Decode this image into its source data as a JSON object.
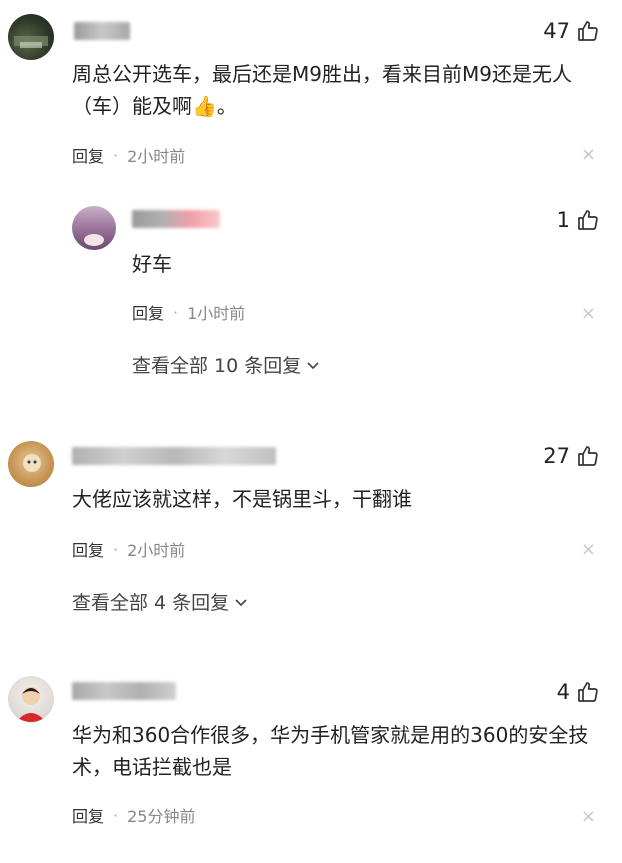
{
  "comments": [
    {
      "likes": "47",
      "text": "周总公开选车，最后还是M9胜出，看来目前M9还是无人（车）能及啊👍。",
      "reply_label": "回复",
      "time": "2小时前",
      "reply": {
        "likes": "1",
        "text": "好车",
        "reply_label": "回复",
        "time": "1小时前"
      },
      "view_all": "查看全部 10 条回复"
    },
    {
      "likes": "27",
      "text": "大佬应该就这样，不是锅里斗，干翻谁",
      "reply_label": "回复",
      "time": "2小时前",
      "view_all": "查看全部 4 条回复"
    },
    {
      "likes": "4",
      "text": "华为和360合作很多，华为手机管家就是用的360的安全技术，电话拦截也是",
      "reply_label": "回复",
      "time": "25分钟前"
    }
  ],
  "close_symbol": "×",
  "dot": "·",
  "icons": {
    "like": "thumbs-up-icon",
    "close": "close-icon",
    "chevron": "chevron-down-icon"
  }
}
